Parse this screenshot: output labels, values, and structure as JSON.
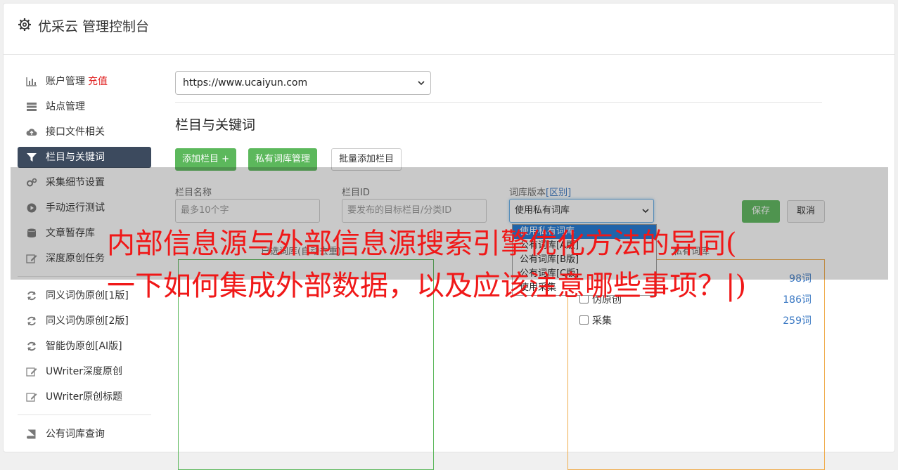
{
  "header": {
    "title": "优采云 管理控制台"
  },
  "sidebar": {
    "items": [
      {
        "label": "账户管理",
        "badge": "充值",
        "icon": "bar-chart-icon"
      },
      {
        "label": "站点管理",
        "icon": "server-icon"
      },
      {
        "label": "接口文件相关",
        "icon": "cloud-upload-icon"
      },
      {
        "label": "栏目与关键词",
        "icon": "filter-icon",
        "active": true
      },
      {
        "label": "采集细节设置",
        "icon": "cogs-icon"
      },
      {
        "label": "手动运行测试",
        "icon": "play-circle-icon"
      },
      {
        "label": "文章暂存库",
        "icon": "database-icon"
      },
      {
        "label": "深度原创任务",
        "icon": "edit-icon"
      }
    ],
    "items2": [
      {
        "label": "同义词伪原创[1版]",
        "icon": "refresh-icon"
      },
      {
        "label": "同义词伪原创[2版]",
        "icon": "refresh-icon"
      },
      {
        "label": "智能伪原创[AI版]",
        "icon": "refresh-icon"
      },
      {
        "label": "UWriter深度原创",
        "icon": "edit-icon"
      },
      {
        "label": "UWriter原创标题",
        "icon": "edit-icon"
      }
    ],
    "items3": [
      {
        "label": "公有词库查询",
        "icon": "book-icon"
      }
    ]
  },
  "main": {
    "site_url": "https://www.ucaiyun.com",
    "section_title": "栏目与关键词",
    "buttons": {
      "add_column": "添加栏目 +",
      "private_lib": "私有词库管理",
      "batch_add": "批量添加栏目"
    },
    "form": {
      "name_label": "栏目名称",
      "name_placeholder": "最多10个字",
      "id_label": "栏目ID",
      "id_placeholder": "要发布的目标栏目/分类ID",
      "version_label": "词库版本",
      "version_link": "[区别]",
      "version_value": "使用私有词库",
      "save": "保存",
      "cancel": "取消"
    },
    "dropdown_options": [
      "使用私有词库",
      "公有词库[A版]",
      "公有词库[B版]",
      "公有词库[C版]",
      "使用采集"
    ],
    "panel_left_title": "已选词库(自动去重)",
    "panel_right_title": "私有词库",
    "libraries": [
      {
        "name": "",
        "count": "98词"
      },
      {
        "name": "伪原创",
        "count": "186词"
      },
      {
        "name": "采集",
        "count": "259词"
      }
    ]
  },
  "overlay": {
    "headline_line1": "内部信息源与外部信息源搜索引擎优化方法的异同(",
    "headline_line2": "一下如何集成外部数据，以及应该注意哪些事项？|)"
  },
  "colors": {
    "accent_green": "#5cb85c",
    "active_nav": "#3c4a5e",
    "headline_red": "#f01818",
    "link_blue": "#3a78c3"
  }
}
